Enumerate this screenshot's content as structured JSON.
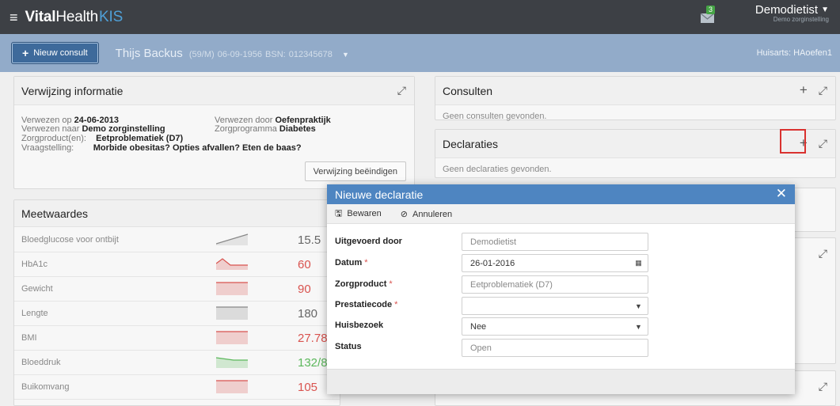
{
  "topbar": {
    "brand_bold": "Vital",
    "brand_rest": "Health",
    "brand_kis": "KIS",
    "mail_count": "3",
    "user_name": "Demodietist",
    "user_org": "Demo zorginstelling"
  },
  "subbar": {
    "new_consult": "Nieuw consult",
    "patient_name": "Thijs Backus",
    "patient_meta": "(59/M)  06-09-1956  BSN: 012345678",
    "huisarts": "Huisarts: HAoefen1"
  },
  "verwijzing": {
    "title": "Verwijzing informatie",
    "l1a_k": "Verwezen op",
    "l1a_v": "24-06-2013",
    "l1b_k": "Verwezen door",
    "l1b_v": "Oefenpraktijk",
    "l2a_k": "Verwezen naar",
    "l2a_v": "Demo zorginstelling",
    "l2b_k": "Zorgprogramma",
    "l2b_v": "Diabetes",
    "l3_k": "Zorgproduct(en):",
    "l3_v": "Eetproblematiek (D7)",
    "l4_k": "Vraagstelling:",
    "l4_v": "Morbide obesitas? Opties afvallen? Eten de baas?",
    "end_button": "Verwijzing beëindigen"
  },
  "meetwaardes": {
    "title": "Meetwaardes",
    "rows": [
      {
        "label": "Bloedglucose voor ontbijt",
        "value": "15.5",
        "color": "#666666",
        "spark": "rise"
      },
      {
        "label": "HbA1c",
        "value": "60",
        "color": "#d9534f",
        "spark": "peak"
      },
      {
        "label": "Gewicht",
        "value": "90",
        "color": "#d9534f",
        "spark": "flat"
      },
      {
        "label": "Lengte",
        "value": "180",
        "color": "#666666",
        "spark": "flat"
      },
      {
        "label": "BMI",
        "value": "27.78",
        "color": "#d9534f",
        "spark": "flat"
      },
      {
        "label": "Bloeddruk",
        "value": "132/82",
        "color": "#5cb85c",
        "spark": "dip"
      },
      {
        "label": "Buikomvang",
        "value": "105",
        "color": "#d9534f",
        "spark": "flat"
      }
    ]
  },
  "consulten": {
    "title": "Consulten",
    "empty": "Geen consulten gevonden."
  },
  "declaraties": {
    "title": "Declaraties",
    "empty": "Geen declaraties gevonden."
  },
  "modal": {
    "title": "Nieuwe declaratie",
    "save": "Bewaren",
    "cancel": "Annuleren",
    "fields": {
      "uitgevoerd": {
        "label": "Uitgevoerd door",
        "value": "Demodietist"
      },
      "datum": {
        "label": "Datum",
        "value": "26-01-2016"
      },
      "zorgproduct": {
        "label": "Zorgproduct",
        "value": "Eetproblematiek (D7)"
      },
      "prestatiecode": {
        "label": "Prestatiecode",
        "value": ""
      },
      "huisbezoek": {
        "label": "Huisbezoek",
        "value": "Nee"
      },
      "status": {
        "label": "Status",
        "value": "Open"
      }
    }
  },
  "colors": {
    "accent": "#4e85c1",
    "topbar": "#3d4045",
    "subbar": "#92abc9",
    "required": "#d9534f",
    "highlight": "#d9322f"
  }
}
